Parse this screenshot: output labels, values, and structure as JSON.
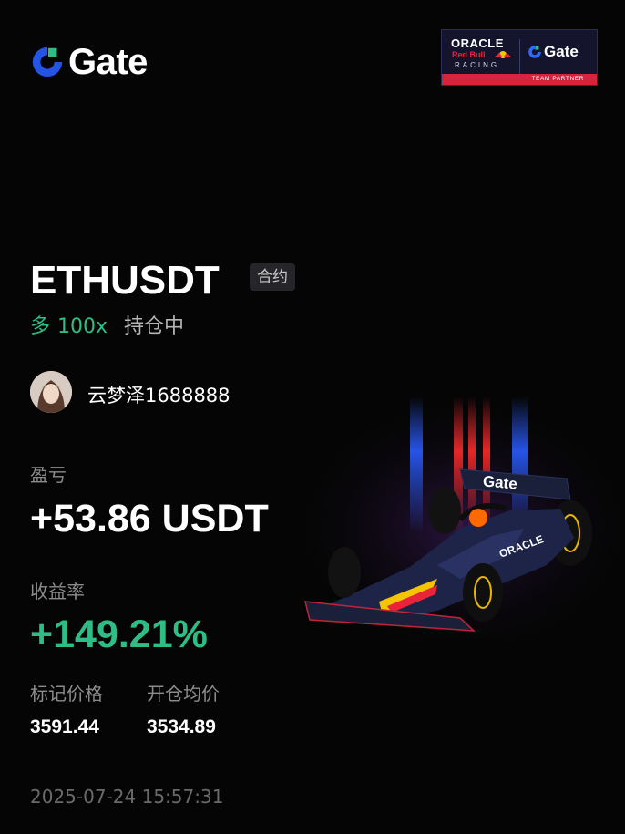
{
  "brand": {
    "name": "Gate",
    "accent": "#2dbd85",
    "logo_blue": "#2354e6"
  },
  "partner": {
    "oracle": "ORACLE",
    "redbull": "Red Bull",
    "racing": "RACING",
    "gate": "Gate",
    "strip": "TEAM PARTNER",
    "car_livery": "Gate"
  },
  "position": {
    "pair": "ETHUSDT",
    "tag": "合约",
    "side": "多",
    "leverage": "100x",
    "status": "持仓中"
  },
  "user": {
    "name": "云梦泽1688888"
  },
  "pnl": {
    "label": "盈亏",
    "value": "+53.86 USDT"
  },
  "roi": {
    "label": "收益率",
    "value": "+149.21%"
  },
  "prices": {
    "mark_label": "标记价格",
    "mark_value": "3591.44",
    "entry_label": "开仓均价",
    "entry_value": "3534.89"
  },
  "timestamp": "2025-07-24 15:57:31"
}
